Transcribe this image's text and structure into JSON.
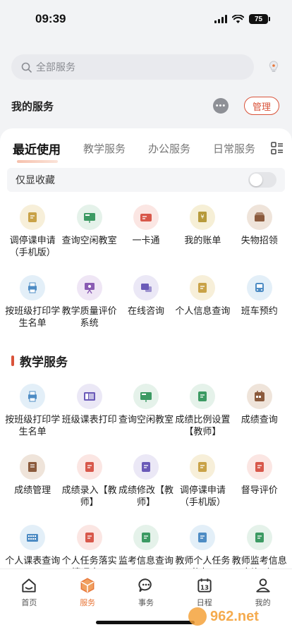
{
  "status": {
    "time": "09:39",
    "battery": "75"
  },
  "search": {
    "placeholder": "全部服务"
  },
  "my_services": {
    "title": "我的服务",
    "manage_label": "管理"
  },
  "tabs": [
    {
      "label": "最近使用",
      "active": true
    },
    {
      "label": "教学服务",
      "active": false
    },
    {
      "label": "办公服务",
      "active": false
    },
    {
      "label": "日常服务",
      "active": false
    }
  ],
  "favorites_toggle": {
    "label": "仅显收藏",
    "on": false
  },
  "recent": [
    {
      "label": "调停课申请（手机版）",
      "icon": "schedule-card-icon",
      "bg": "#f7efd9",
      "fg": "#c9a247"
    },
    {
      "label": "查询空闲教室",
      "icon": "classroom-board-icon",
      "bg": "#e5f2ea",
      "fg": "#3c9a63"
    },
    {
      "label": "一卡通",
      "icon": "id-card-icon",
      "bg": "#fbe6e3",
      "fg": "#d8584b"
    },
    {
      "label": "我的账单",
      "icon": "bill-icon",
      "bg": "#f6efd6",
      "fg": "#b79a3a"
    },
    {
      "label": "失物招领",
      "icon": "lost-box-icon",
      "bg": "#efe4da",
      "fg": "#8b5a3c"
    },
    {
      "label": "按班级打印学生名单",
      "icon": "printer-icon",
      "bg": "#e3eff8",
      "fg": "#4e8cc4"
    },
    {
      "label": "教学质量评价系统",
      "icon": "evaluation-board-icon",
      "bg": "#efe6f5",
      "fg": "#8a5bb3"
    },
    {
      "label": "在线咨询",
      "icon": "consult-icon",
      "bg": "#ebe8f6",
      "fg": "#6a5ab8"
    },
    {
      "label": "个人信息查询",
      "icon": "person-card-icon",
      "bg": "#f7efd9",
      "fg": "#c9a247"
    },
    {
      "label": "班车预约",
      "icon": "bus-icon",
      "bg": "#e3eff8",
      "fg": "#4e8cc4"
    }
  ],
  "teaching_section": {
    "title": "教学服务"
  },
  "teaching": [
    {
      "label": "按班级打印学生名单",
      "icon": "printer-icon",
      "bg": "#e3eff8",
      "fg": "#4e8cc4"
    },
    {
      "label": "班级课表打印",
      "icon": "timetable-icon",
      "bg": "#ebe8f6",
      "fg": "#6a5ab8"
    },
    {
      "label": "查询空闲教室",
      "icon": "classroom-board-icon",
      "bg": "#e5f2ea",
      "fg": "#3c9a63"
    },
    {
      "label": "成绩比例设置【教师】",
      "icon": "grade-ratio-icon",
      "bg": "#e5f2ea",
      "fg": "#3c9a63"
    },
    {
      "label": "成绩查询",
      "icon": "calendar-grade-icon",
      "bg": "#efe4da",
      "fg": "#8b5a3c"
    },
    {
      "label": "成绩管理",
      "icon": "notebook-icon",
      "bg": "#efe4da",
      "fg": "#8b5a3c"
    },
    {
      "label": "成绩录入【教师】",
      "icon": "grade-entry-icon",
      "bg": "#fbe6e3",
      "fg": "#d8584b"
    },
    {
      "label": "成绩修改【教师】",
      "icon": "grade-edit-icon",
      "bg": "#ebe8f6",
      "fg": "#6a5ab8"
    },
    {
      "label": "调停课申请（手机版）",
      "icon": "schedule-card-icon",
      "bg": "#f7efd9",
      "fg": "#c9a247"
    },
    {
      "label": "督导评价",
      "icon": "supervision-icon",
      "bg": "#fbe6e3",
      "fg": "#d8584b"
    },
    {
      "label": "个人课表查询",
      "icon": "keyboard-grid-icon",
      "bg": "#e3eff8",
      "fg": "#4e8cc4"
    },
    {
      "label": "个人任务落实情况查...",
      "icon": "task-folder-icon",
      "bg": "#fbe6e3",
      "fg": "#d8584b"
    },
    {
      "label": "监考信息查询",
      "icon": "exam-download-icon",
      "bg": "#e5f2ea",
      "fg": "#3c9a63"
    },
    {
      "label": "教师个人任务书查...",
      "icon": "task-doc-icon",
      "bg": "#e3eff8",
      "fg": "#4e8cc4"
    },
    {
      "label": "教师监考信息查询（...",
      "icon": "exam-person-icon",
      "bg": "#e5f2ea",
      "fg": "#3c9a63"
    }
  ],
  "tabbar": [
    {
      "label": "首页",
      "icon": "home-icon",
      "active": false
    },
    {
      "label": "服务",
      "icon": "service-cube-icon",
      "active": true
    },
    {
      "label": "事务",
      "icon": "chat-icon",
      "active": false
    },
    {
      "label": "日程",
      "icon": "calendar-icon",
      "active": false,
      "day": "13"
    },
    {
      "label": "我的",
      "icon": "profile-icon",
      "active": false
    }
  ],
  "colors": {
    "accent": "#d9533a",
    "tab_active": "#e8773a"
  },
  "watermark": {
    "text": "962.net",
    "subtext": "乐游网"
  }
}
